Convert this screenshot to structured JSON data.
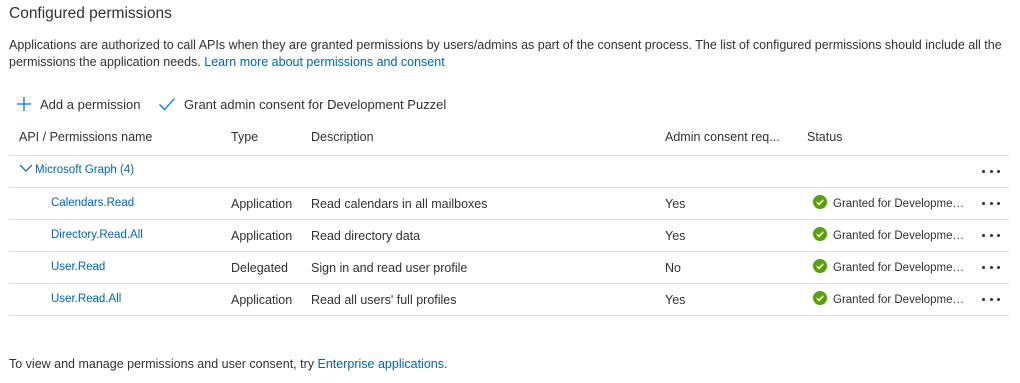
{
  "section": {
    "title": "Configured permissions",
    "description": "Applications are authorized to call APIs when they are granted permissions by users/admins as part of the consent process. The list of configured permissions should include all the permissions the application needs.",
    "learn_more_link": "Learn more about permissions and consent"
  },
  "commands": {
    "add_permission": {
      "label": "Add a permission",
      "icon": "plus-icon"
    },
    "grant_consent": {
      "label": "Grant admin consent for Development Puzzel",
      "icon": "checkmark-icon"
    }
  },
  "table": {
    "columns": [
      "API / Permissions name",
      "Type",
      "Description",
      "Admin consent req...",
      "Status"
    ],
    "group": {
      "label": "Microsoft Graph (4)",
      "icon": "chevron-down-icon"
    },
    "rows": [
      {
        "name": "Calendars.Read",
        "type": "Application",
        "description": "Read calendars in all mailboxes",
        "admin_consent": "Yes",
        "status": "Granted for Development Puzzel"
      },
      {
        "name": "Directory.Read.All",
        "type": "Application",
        "description": "Read directory data",
        "admin_consent": "Yes",
        "status": "Granted for Development Puzzel"
      },
      {
        "name": "User.Read",
        "type": "Delegated",
        "description": "Sign in and read user profile",
        "admin_consent": "No",
        "status": "Granted for Development Puzzel"
      },
      {
        "name": "User.Read.All",
        "type": "Application",
        "description": "Read all users' full profiles",
        "admin_consent": "Yes",
        "status": "Granted for Development Puzzel"
      }
    ]
  },
  "footer": {
    "text": "To view and manage permissions and user consent, try",
    "link": "Enterprise applications",
    "suffix": "."
  },
  "colors": {
    "link": "#0063b1",
    "success": "#57a300",
    "text": "#323130",
    "divider": "#e1dfdd"
  }
}
